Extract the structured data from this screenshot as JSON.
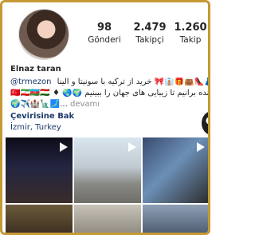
{
  "profile": {
    "avatar_icon": "profile-photo",
    "name": "Elnaz taran",
    "stats": {
      "posts": {
        "value": "98",
        "label": "Gönderi"
      },
      "followers": {
        "value": "2.479",
        "label": "Takipçi"
      },
      "following": {
        "value": "1.260",
        "label": "Takip"
      }
    },
    "bio": {
      "mention": "@trmezon",
      "line1_rtl": "👗👠👜🎁👔🎀 خرید از ترکیه با سونیتا و الینا",
      "line2": "🇹🇷🇮🇷🇦🇿🇹🇯 ♦ 🌏🌍 زنده برآنیم تا زیبایی های جهان را ببینیم#",
      "line3": "🌍✈️🏰🗽🗾... ",
      "more": "devamı"
    },
    "translate_label": "Çevirisine Bak",
    "location": "İzmir, Turkey"
  },
  "posts_grid": {
    "tiles": [
      {
        "type": "video",
        "icon": "play-icon"
      },
      {
        "type": "video",
        "icon": "play-icon"
      },
      {
        "type": "video",
        "icon": "play-icon"
      },
      {
        "type": "video"
      },
      {
        "type": "video"
      },
      {
        "type": "video"
      }
    ]
  },
  "ui": {
    "pointer_icon": "hand-pointer-icon",
    "frame_color": "#c59a35",
    "link_color": "#1b3a6b"
  }
}
